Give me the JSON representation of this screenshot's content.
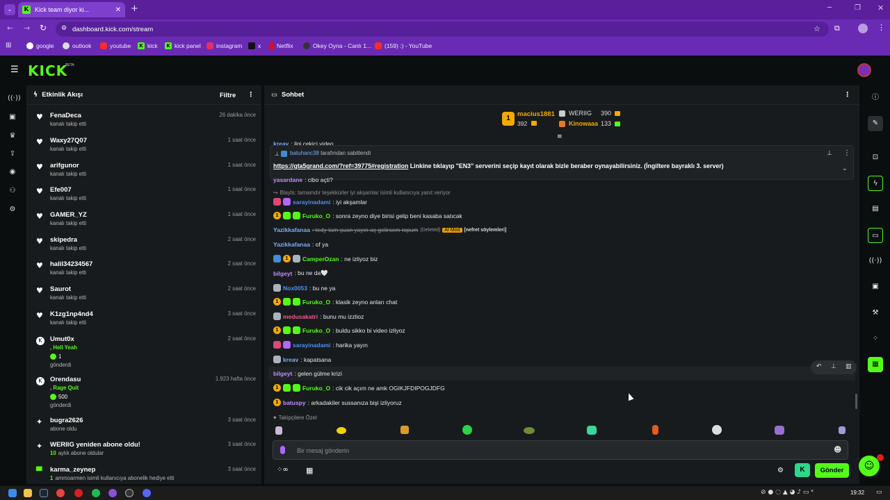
{
  "browser": {
    "tab_title": "Kick team diyor ki...",
    "url": "dashboard.kick.com/stream",
    "bookmarks": [
      "google",
      "outlook",
      "youtube",
      "kick",
      "kick panel",
      "instagram",
      "x",
      "Netflix",
      "Okey Oyna - Canlı 1...",
      "(159) :) - YouTube"
    ]
  },
  "kick": {
    "logo": "KICK",
    "beta": "BETA"
  },
  "activity": {
    "title": "Etkinlik Akışı",
    "filter_label": "Filtre",
    "items": [
      {
        "name": "FenaDeca",
        "sub": "kanalı takip etti",
        "time": "26 dakika önce"
      },
      {
        "name": "Waxy27Q07",
        "sub": "kanalı takip etti",
        "time": "1 saat önce"
      },
      {
        "name": "arifgunor",
        "sub": "kanalı takip etti",
        "time": "1 saat önce"
      },
      {
        "name": "Efe007",
        "sub": "kanalı takip etti",
        "time": "1 saat önce"
      },
      {
        "name": "GAMER_YZ",
        "sub": "kanalı takip etti",
        "time": "1 saat önce"
      },
      {
        "name": "skipedra",
        "sub": "kanalı takip etti",
        "time": "2 saat önce"
      },
      {
        "name": "halil34234567",
        "sub": "kanalı takip etti",
        "time": "2 saat önce"
      },
      {
        "name": "Saurot",
        "sub": "kanalı takip etti",
        "time": "2 saat önce"
      },
      {
        "name": "K1zg1np4nd4",
        "sub": "kanalı takip etti",
        "time": "3 saat önce"
      },
      {
        "name": "Umut0x",
        "extra": ", Hell Yeah",
        "amount": "1",
        "sub": "gönderdi",
        "time": "2 saat önce"
      },
      {
        "name": "Orendasu",
        "extra": ", Rage Quit",
        "amount": "500",
        "sub": "gönderdi",
        "time": "1.923 hafta önce"
      },
      {
        "name": "bugra2626",
        "sub": "abone oldu",
        "time": "3 saat önce"
      },
      {
        "name": "WERIIG yeniden abone oldu!",
        "sub_green": "10",
        "sub": "aylık abone oldular",
        "time": "3 saat önce"
      },
      {
        "name": "karma_zeynep",
        "sub_green": "1",
        "sub": "ammoarmen isimli kullanıcıya abonelik hediye etti",
        "time": "3 saat önce"
      }
    ]
  },
  "chat": {
    "title": "Sohbet",
    "leaderboard": {
      "top": {
        "name": "macius1881",
        "count": "392",
        "rank": "1"
      },
      "second": {
        "name": "WERIIG",
        "count": "390"
      },
      "third": {
        "name": "Kinowaaa",
        "count": "133"
      }
    },
    "partial_top": {
      "user": "kreav",
      "text": ": ilgi çekici video"
    },
    "pinned": {
      "by_user": "batuhanc38",
      "by_suffix": "tarafından sabitlendi",
      "link": "https://gta5grand.com/?ref=39775#registration",
      "text": " Linkine tıklayıp \"EN3\" serverini seçip kayıt olarak bizle beraber oynayabilirsiniz. (İngiltere bayraklı 3. server)"
    },
    "partial_under": {
      "user": "yasardane",
      "text": ": cibo açti?"
    },
    "reply_line": "Blayts: tamamdır teşekkürler iyi akşamlar isimli kullanıcıya yanıt veriyor",
    "messages": [
      {
        "user": "sarayinadami",
        "text": ": iyi akşamlar",
        "color": "#4f8ef7"
      },
      {
        "user": "Furuko_O",
        "text": ": sonra zeyno diye birisi gelip beni kasaba satıcak",
        "color": "#53fc18"
      },
      {
        "user": "Yazikkafanaa",
        "text": ": tedy tam şuan yayın aç gelirsem topum",
        "deleted": "(Deleted)",
        "mod": "AI Mod",
        "reason": "[nefret söylemleri]",
        "color": "#7aaef7"
      },
      {
        "user": "Yazikkafanaa",
        "text": ": of ya",
        "color": "#7aaef7"
      },
      {
        "user": "CamperOzan",
        "text": ": ne izliyoz biz",
        "color": "#53fc18"
      },
      {
        "user": "bilgeyt",
        "text": ": bu ne da🤍",
        "color": "#c08cff"
      },
      {
        "user": "Nox0053",
        "text": ": bu ne ya",
        "color": "#4f8ef7"
      },
      {
        "user": "Furuko_O",
        "text": ": klasik zeyno anları chat",
        "color": "#53fc18"
      },
      {
        "user": "medusakatri",
        "text": ": bunu mu izzlioz",
        "color": "#f25a8c"
      },
      {
        "user": "Furuko_O",
        "text": ": buldu sikko bi video izliyoz",
        "color": "#53fc18"
      },
      {
        "user": "sarayinadami",
        "text": ": harika yayın",
        "color": "#4f8ef7"
      },
      {
        "user": "kreav",
        "text": ": kapatsana",
        "color": "#7aaef7"
      },
      {
        "user": "bilgeyt",
        "text": ": gelen gülme krizi",
        "color": "#c08cff"
      },
      {
        "user": "Furuko_O",
        "text": ": cik cik açım ne amk OGIKJFDIPOGJDFG",
        "color": "#53fc18"
      },
      {
        "user": "batuspy",
        "text": ": arkadakiler sussanıza bişi izliyoruz",
        "color": "#c08cff"
      }
    ],
    "followers_label": "Takipçilere Özel",
    "input_placeholder": "Bir mesaj gönderin",
    "send_label": "Gönder"
  },
  "taskbar": {
    "time": "19:32"
  },
  "colors": {
    "kick_green": "#53fc18",
    "browser_purple": "#6a2bb4",
    "panel": "#181b1d"
  }
}
